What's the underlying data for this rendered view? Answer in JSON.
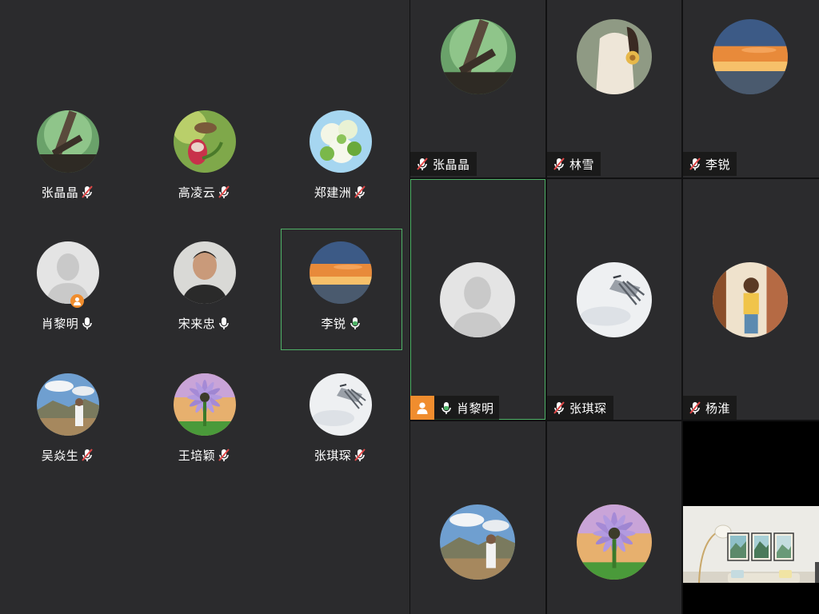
{
  "colors": {
    "background": "#2b2b2d",
    "speaking_border": "#4fb267",
    "host_badge": "#f08d2e",
    "muted_red": "#e24848",
    "text": "#ffffff"
  },
  "participant_list": [
    {
      "name": "张晶晶",
      "mic": "muted",
      "avatar": "tree-branch-photo"
    },
    {
      "name": "高凌云",
      "mic": "muted",
      "avatar": "bird-on-flower-photo"
    },
    {
      "name": "郑建洲",
      "mic": "muted",
      "avatar": "white-flowers-photo"
    },
    {
      "name": "肖黎明",
      "mic": "on",
      "avatar": "default-person",
      "host": true
    },
    {
      "name": "宋来忠",
      "mic": "on",
      "avatar": "portrait-photo"
    },
    {
      "name": "李锐",
      "mic": "on",
      "avatar": "sunset-photo",
      "selected": true
    },
    {
      "name": "吴焱生",
      "mic": "muted",
      "avatar": "mountain-man-photo"
    },
    {
      "name": "王培颖",
      "mic": "muted",
      "avatar": "purple-daisy-photo"
    },
    {
      "name": "张琪琛",
      "mic": "muted",
      "avatar": "snow-sketch-photo"
    }
  ],
  "video_tiles": [
    {
      "name": "张晶晶",
      "mic": "muted",
      "avatar": "tree-branch-photo"
    },
    {
      "name": "林雪",
      "mic": "muted",
      "avatar": "illustrated-girl-photo"
    },
    {
      "name": "李锐",
      "mic": "muted",
      "avatar": "sunset-photo"
    },
    {
      "name": "肖黎明",
      "mic": "on",
      "avatar": "default-person",
      "host": true,
      "speaking": true
    },
    {
      "name": "张琪琛",
      "mic": "muted",
      "avatar": "snow-sketch-photo"
    },
    {
      "name": "杨淮",
      "mic": "muted",
      "avatar": "girl-doorway-photo"
    },
    {
      "name": "",
      "mic": "none",
      "avatar": "mountain-man-photo"
    },
    {
      "name": "",
      "mic": "none",
      "avatar": "purple-daisy-photo"
    },
    {
      "name": "",
      "mic": "none",
      "avatar": "room-camera-feed"
    }
  ]
}
